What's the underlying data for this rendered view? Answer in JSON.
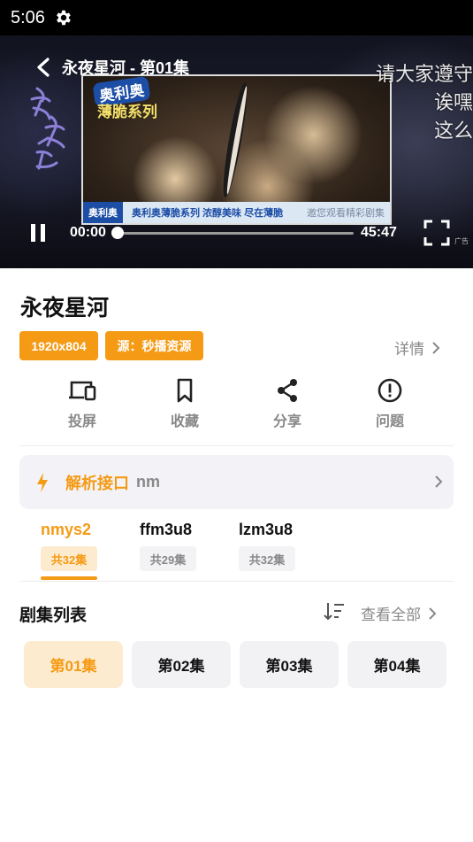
{
  "status_bar": {
    "time": "5:06"
  },
  "player": {
    "title": "永夜星河 - 第01集",
    "current_time": "00:00",
    "total_time": "45:47",
    "progress": 0,
    "subtitles": [
      "请大家遵守",
      "诶嘿",
      "这么"
    ],
    "ad": {
      "brand": "奥利奥",
      "brand_line2": "薄脆系列",
      "strip_logo": "奥利奥",
      "strip_slogan": "奥利奥薄脆系列 浓醇美味 尽在薄脆",
      "strip_more": "邀您观看精彩剧集"
    },
    "ad_tag": "广告"
  },
  "show": {
    "title": "永夜星河",
    "resolution_tag": "1920x804",
    "source_tag": "源：秒播资源",
    "details_label": "详情"
  },
  "actions": [
    {
      "label": "投屏",
      "icon": "cast-icon"
    },
    {
      "label": "收藏",
      "icon": "bookmark-icon"
    },
    {
      "label": "分享",
      "icon": "share-icon"
    },
    {
      "label": "问题",
      "icon": "alert-icon"
    }
  ],
  "api": {
    "label": "解析接口",
    "value": "nm"
  },
  "sources": [
    {
      "name": "nmys2",
      "count": "共32集",
      "active": true
    },
    {
      "name": "ffm3u8",
      "count": "共29集",
      "active": false
    },
    {
      "name": "lzm3u8",
      "count": "共32集",
      "active": false
    }
  ],
  "episodes": {
    "heading": "剧集列表",
    "view_all": "查看全部",
    "items": [
      "第01集",
      "第02集",
      "第03集",
      "第04集"
    ],
    "selected_index": 0
  },
  "colors": {
    "accent": "#f59a14",
    "accent_light": "#fdebd0"
  }
}
